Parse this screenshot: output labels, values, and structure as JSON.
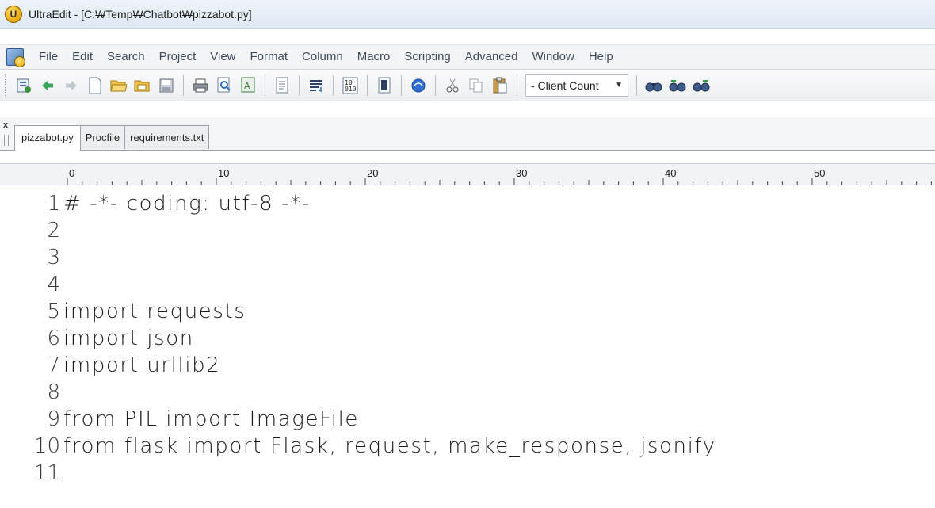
{
  "window": {
    "title": "UltraEdit - [C:₩Temp₩Chatbot₩pizzabot.py]"
  },
  "menu": {
    "items": [
      "File",
      "Edit",
      "Search",
      "Project",
      "View",
      "Format",
      "Column",
      "Macro",
      "Scripting",
      "Advanced",
      "Window",
      "Help"
    ]
  },
  "toolbar": {
    "combo_value": "- Client Count"
  },
  "tabs": {
    "close_label": "x",
    "items": [
      "pizzabot.py",
      "Procfile",
      "requirements.txt"
    ],
    "active": "pizzabot.py"
  },
  "ruler": {
    "labels": [
      "0",
      "10",
      "20",
      "30",
      "40",
      "50"
    ]
  },
  "editor": {
    "lines": [
      {
        "num": "1",
        "code": "# -*- coding: utf-8 -*-"
      },
      {
        "num": "2",
        "code": ""
      },
      {
        "num": "3",
        "code": ""
      },
      {
        "num": "4",
        "code": ""
      },
      {
        "num": "5",
        "code": "import requests"
      },
      {
        "num": "6",
        "code": "import json"
      },
      {
        "num": "7",
        "code": "import urllib2"
      },
      {
        "num": "8",
        "code": ""
      },
      {
        "num": "9",
        "code": "from PIL import ImageFile"
      },
      {
        "num": "10",
        "code": "from flask import Flask, request, make_response, jsonify"
      },
      {
        "num": "11",
        "code": ""
      }
    ]
  }
}
